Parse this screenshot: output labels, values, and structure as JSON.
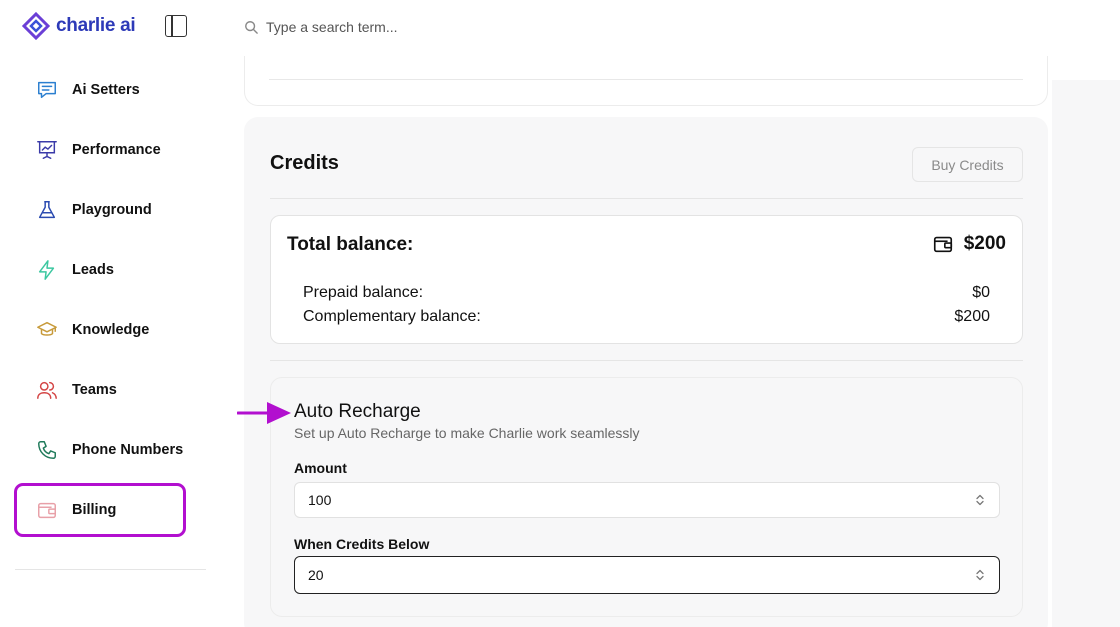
{
  "app": {
    "name": "charlie ai",
    "brand_color": "#2d3ab8",
    "highlight_color": "#b20fcf"
  },
  "search": {
    "placeholder": "Type a search term..."
  },
  "sidebar": {
    "items": [
      {
        "label": "Ai Setters",
        "icon": "chat-icon",
        "color": "#2b7fd0"
      },
      {
        "label": "Performance",
        "icon": "presentation-chart-icon",
        "color": "#3a3aa8"
      },
      {
        "label": "Playground",
        "icon": "flask-icon",
        "color": "#2a4ab0"
      },
      {
        "label": "Leads",
        "icon": "lightning-icon",
        "color": "#3cc7a0"
      },
      {
        "label": "Knowledge",
        "icon": "graduation-cap-icon",
        "color": "#c79a3a"
      },
      {
        "label": "Teams",
        "icon": "users-icon",
        "color": "#d44545"
      },
      {
        "label": "Phone Numbers",
        "icon": "phone-icon",
        "color": "#1f7a5a"
      },
      {
        "label": "Billing",
        "icon": "wallet-icon",
        "color": "#e8a0a8",
        "active": true
      }
    ]
  },
  "credits": {
    "title": "Credits",
    "buy_label": "Buy Credits",
    "total_label": "Total balance:",
    "total_value": "$200",
    "prepaid_label": "Prepaid balance:",
    "prepaid_value": "$0",
    "complementary_label": "Complementary balance:",
    "complementary_value": "$200"
  },
  "auto_recharge": {
    "title": "Auto Recharge",
    "subtitle": "Set up Auto Recharge to make Charlie work seamlessly",
    "amount_label": "Amount",
    "amount_value": "100",
    "below_label": "When Credits Below",
    "below_value": "20"
  }
}
